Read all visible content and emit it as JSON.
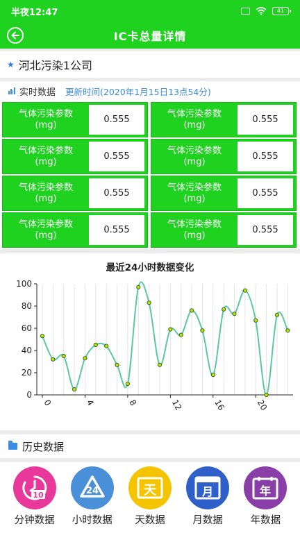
{
  "status_bar": {
    "time": "半夜12:47",
    "battery": "41"
  },
  "app_bar": {
    "title": "IC卡总量详情"
  },
  "company": {
    "name": "河北污染1公司"
  },
  "realtime": {
    "label": "实时数据",
    "update_time": "更新时间(2020年1月15日13点54分)",
    "cells": [
      {
        "name": "气体污染参数",
        "unit": "(mg)",
        "value": "0.555"
      },
      {
        "name": "气体污染参数",
        "unit": "(mg)",
        "value": "0.555"
      },
      {
        "name": "气体污染参数",
        "unit": "(mg)",
        "value": "0.555"
      },
      {
        "name": "气体污染参数",
        "unit": "(mg)",
        "value": "0.555"
      },
      {
        "name": "气体污染参数",
        "unit": "(mg)",
        "value": "0.555"
      },
      {
        "name": "气体污染参数",
        "unit": "(mg)",
        "value": "0.555"
      },
      {
        "name": "气体污染参数",
        "unit": "(mg)",
        "value": "0.555"
      },
      {
        "name": "气体污染参数",
        "unit": "(mg)",
        "value": "0.555"
      }
    ]
  },
  "chart_data": {
    "type": "line",
    "title": "最近24小时数据变化",
    "x": [
      0,
      1,
      2,
      3,
      4,
      5,
      6,
      7,
      8,
      9,
      10,
      11,
      12,
      13,
      14,
      15,
      16,
      17,
      18,
      19,
      20,
      21,
      22,
      23
    ],
    "series": [
      {
        "values": [
          53,
          32,
          35,
          5,
          33,
          45,
          44,
          27,
          10,
          97,
          83,
          27,
          59,
          54,
          76,
          58,
          18,
          77,
          73,
          94,
          67,
          0,
          72,
          58
        ]
      }
    ],
    "xticks": [
      "0",
      "4",
      "8",
      "12",
      "16",
      "20"
    ],
    "yticks": [
      "0",
      "20",
      "40",
      "60",
      "80",
      "100"
    ],
    "ylim": [
      0,
      100
    ],
    "xlim": [
      0,
      23
    ],
    "grid": "vertical",
    "line_color": "#5ac8a0",
    "point_color": "#c8e000"
  },
  "history": {
    "label": "历史数据"
  },
  "nav": [
    {
      "label": "分钟数据",
      "icon": "minute-clock-icon",
      "color": "#e8389a",
      "glyph": "10"
    },
    {
      "label": "小时数据",
      "icon": "hour-recycle-icon",
      "color": "#4a90d9",
      "glyph": "24"
    },
    {
      "label": "天数据",
      "icon": "day-calendar-icon",
      "color": "#f5c400",
      "glyph": "天"
    },
    {
      "label": "月数据",
      "icon": "month-calendar-icon",
      "color": "#2f5fc8",
      "glyph": "月"
    },
    {
      "label": "年数据",
      "icon": "year-calendar-icon",
      "color": "#8a3fa8",
      "glyph": "年"
    }
  ]
}
